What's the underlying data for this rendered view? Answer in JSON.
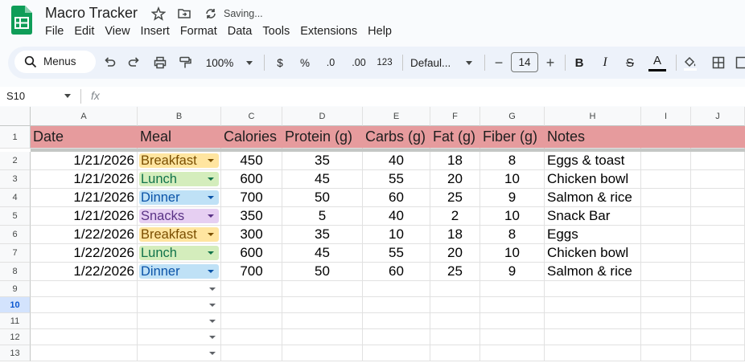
{
  "app": {
    "title": "Macro Tracker",
    "status": "Saving...",
    "menus": [
      "File",
      "Edit",
      "View",
      "Insert",
      "Format",
      "Data",
      "Tools",
      "Extensions",
      "Help"
    ]
  },
  "toolbar": {
    "search_label": "Menus",
    "zoom": "100%",
    "currency": "$",
    "percent": "%",
    "dec_decrease": ".0",
    "dec_increase": ".00",
    "number_format": "123",
    "font": "Defaul...",
    "font_size": "14",
    "minus": "−",
    "plus": "+",
    "bold": "B",
    "italic": "I",
    "strike": "S",
    "textcolor": "A"
  },
  "formula_bar": {
    "name_box": "S10",
    "fx": "fx",
    "value": ""
  },
  "sheet": {
    "columns": [
      "A",
      "B",
      "C",
      "D",
      "E",
      "F",
      "G",
      "H",
      "I",
      "J"
    ],
    "header_row": [
      "Date",
      "Meal",
      "Calories",
      "Protein (g)",
      "Carbs (g)",
      "Fat (g)",
      "Fiber (g)",
      "Notes",
      "",
      ""
    ],
    "rows": [
      {
        "num": "2",
        "cells": [
          "1/21/2026",
          "Breakfast",
          "450",
          "35",
          "40",
          "18",
          "8",
          "Eggs & toast"
        ]
      },
      {
        "num": "3",
        "cells": [
          "1/21/2026",
          "Lunch",
          "600",
          "45",
          "55",
          "20",
          "10",
          "Chicken bowl"
        ]
      },
      {
        "num": "4",
        "cells": [
          "1/21/2026",
          "Dinner",
          "700",
          "50",
          "60",
          "25",
          "9",
          "Salmon & rice"
        ]
      },
      {
        "num": "5",
        "cells": [
          "1/21/2026",
          "Snacks",
          "350",
          "5",
          "40",
          "2",
          "10",
          "Snack Bar"
        ]
      },
      {
        "num": "6",
        "cells": [
          "1/22/2026",
          "Breakfast",
          "300",
          "35",
          "10",
          "18",
          "8",
          "Eggs"
        ]
      },
      {
        "num": "7",
        "cells": [
          "1/22/2026",
          "Lunch",
          "600",
          "45",
          "55",
          "20",
          "10",
          "Chicken bowl"
        ]
      },
      {
        "num": "8",
        "cells": [
          "1/22/2026",
          "Dinner",
          "700",
          "50",
          "60",
          "25",
          "9",
          "Salmon & rice"
        ]
      }
    ],
    "empty_rows": [
      "9",
      "10",
      "11",
      "12",
      "13"
    ],
    "selected_row": "10",
    "meal_colors": {
      "Breakfast": {
        "bg": "#ffe5a0",
        "fg": "#7a4f01"
      },
      "Lunch": {
        "bg": "#d4edbc",
        "fg": "#11734b"
      },
      "Dinner": {
        "bg": "#bfe1f6",
        "fg": "#0a53a8"
      },
      "Snacks": {
        "bg": "#e6cff2",
        "fg": "#5a3286"
      }
    },
    "header_bg": "#e69b9d"
  }
}
